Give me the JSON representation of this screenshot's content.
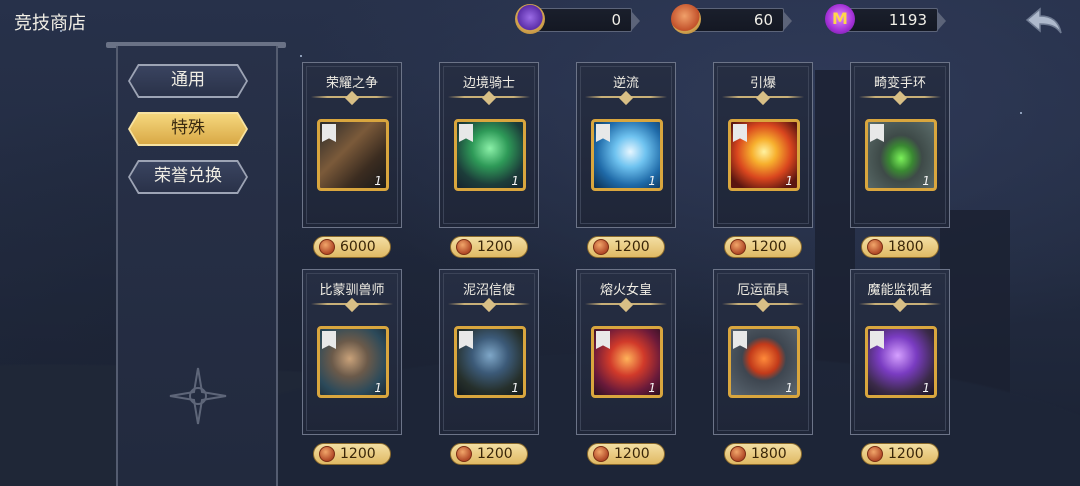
{
  "header": {
    "title": "竞技商店",
    "resources": [
      {
        "name": "honor-crest",
        "value": "0",
        "color": "#8a4fd8"
      },
      {
        "name": "arena-coin",
        "value": "60",
        "color": "#c9532c"
      },
      {
        "name": "m-gem",
        "value": "1193",
        "color": "#b23de0"
      }
    ],
    "back_icon": "back-arrow-icon"
  },
  "nav": {
    "tabs": [
      {
        "label": "通用",
        "active": false
      },
      {
        "label": "特殊",
        "active": true
      },
      {
        "label": "荣誉兑换",
        "active": false
      }
    ]
  },
  "shop": {
    "items": [
      {
        "name": "荣耀之争",
        "qty": "1",
        "price": "6000",
        "art": "battle-scroll"
      },
      {
        "name": "边境骑士",
        "qty": "1",
        "price": "1200",
        "art": "green-knight"
      },
      {
        "name": "逆流",
        "qty": "1",
        "price": "1200",
        "art": "ice-wave"
      },
      {
        "name": "引爆",
        "qty": "1",
        "price": "1200",
        "art": "fire-blast"
      },
      {
        "name": "畸变手环",
        "qty": "1",
        "price": "1800",
        "art": "green-bracelet"
      },
      {
        "name": "比蒙驯兽师",
        "qty": "1",
        "price": "1200",
        "art": "beast-tamer"
      },
      {
        "name": "泥沼信使",
        "qty": "1",
        "price": "1200",
        "art": "swamp-messenger"
      },
      {
        "name": "熔火女皇",
        "qty": "1",
        "price": "1200",
        "art": "lava-queen"
      },
      {
        "name": "厄运面具",
        "qty": "1",
        "price": "1800",
        "art": "doom-mask"
      },
      {
        "name": "魔能监视者",
        "qty": "1",
        "price": "1200",
        "art": "arcane-watcher"
      }
    ]
  }
}
